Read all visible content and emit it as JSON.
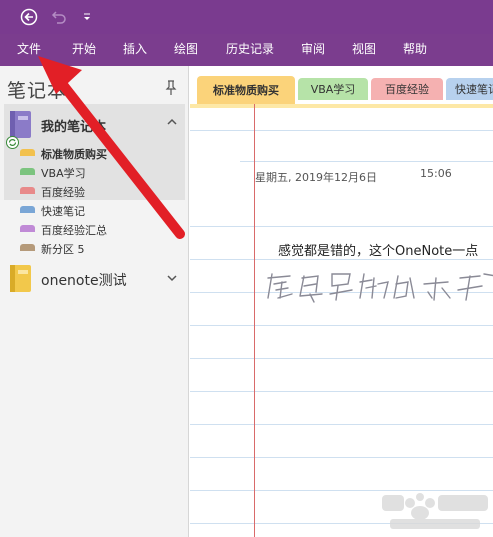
{
  "quick_access": {
    "back_icon": "back-arrow-icon",
    "undo_icon": "undo-icon",
    "dropdown_icon": "customize-dropdown-icon"
  },
  "ribbon": {
    "tabs": [
      "文件",
      "开始",
      "插入",
      "绘图",
      "历史记录",
      "审阅",
      "视图",
      "帮助"
    ]
  },
  "notebook_pane": {
    "heading": "笔记本",
    "current_notebook": "我的笔记本",
    "sections": [
      {
        "label": "标准物质购买",
        "color": "#f2c14e"
      },
      {
        "label": "VBA学习",
        "color": "#7cc47f"
      },
      {
        "label": "百度经验",
        "color": "#e88a8a"
      },
      {
        "label": "快速笔记",
        "color": "#7aa6d6"
      },
      {
        "label": "百度经验汇总",
        "color": "#c08ad6"
      },
      {
        "label": "新分区 5",
        "color": "#b59a7a"
      }
    ],
    "other_notebook": "onenote测试"
  },
  "section_tabs": [
    {
      "label": "标准物质购买",
      "color": "#fbd37a"
    },
    {
      "label": "VBA学习",
      "color": "#b6e3a8"
    },
    {
      "label": "百度经验",
      "color": "#f5b1b1"
    },
    {
      "label": "快速笔记",
      "color": "#b7d1ee"
    }
  ],
  "page": {
    "date": "星期五, 2019年12月6日",
    "time": "15:06",
    "typed_text": "感觉都是错的，这个OneNote一点",
    "handwriting": "感觉都是错的，这个"
  },
  "colors": {
    "title_bar": "#7a3b8f",
    "annotation_arrow": "#e21f26"
  }
}
